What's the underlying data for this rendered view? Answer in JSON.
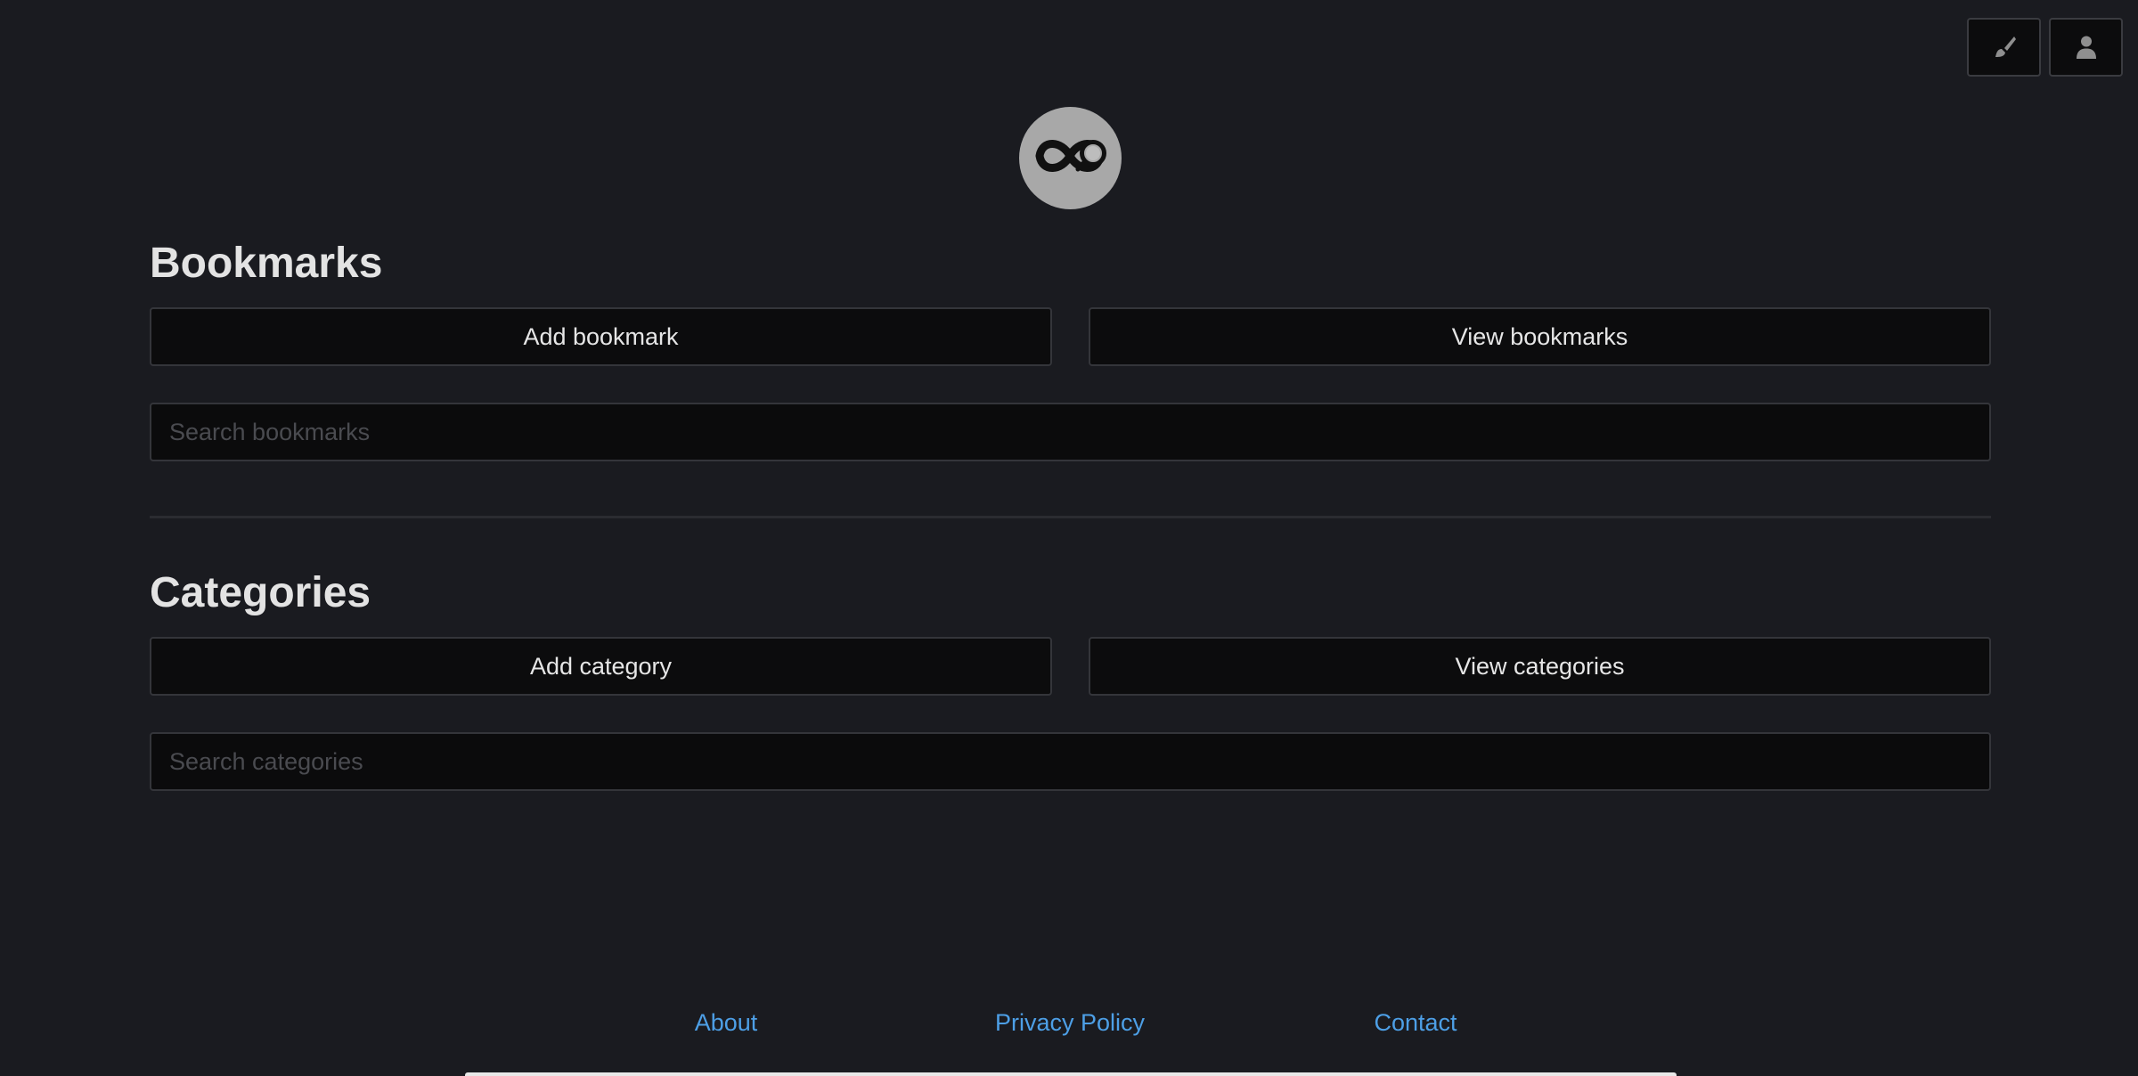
{
  "toolbar": {
    "theme_icon": "paintbrush-icon",
    "account_icon": "user-icon"
  },
  "logo": {
    "icon": "infinity-magnifier-logo"
  },
  "bookmarks": {
    "title": "Bookmarks",
    "add_label": "Add bookmark",
    "view_label": "View bookmarks",
    "search_placeholder": "Search bookmarks",
    "search_value": ""
  },
  "categories": {
    "title": "Categories",
    "add_label": "Add category",
    "view_label": "View categories",
    "search_placeholder": "Search categories",
    "search_value": ""
  },
  "footer": {
    "links": [
      {
        "label": "About"
      },
      {
        "label": "Privacy Policy"
      },
      {
        "label": "Contact"
      }
    ]
  },
  "colors": {
    "background": "#1a1b20",
    "button_bg": "#0c0c0d",
    "link": "#4d9fe6",
    "text": "#e3e3e3"
  }
}
